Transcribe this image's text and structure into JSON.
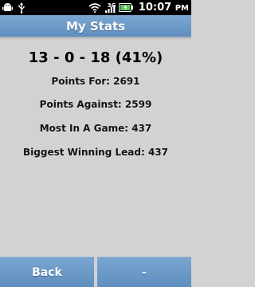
{
  "status_bar": {
    "time": "10:07",
    "ampm": "PM",
    "network_label": "3G",
    "icons": [
      "android-debug-icon",
      "usb-icon",
      "wifi-icon",
      "signal-icon",
      "battery-icon"
    ]
  },
  "header": {
    "title": "My Stats"
  },
  "stats": {
    "record": "13 - 0 - 18 (41%)",
    "points_for": "Points For: 2691",
    "points_against": "Points Against: 2599",
    "most_in_game": "Most In A Game: 437",
    "biggest_winning_lead": "Biggest Winning Lead: 437"
  },
  "buttons": {
    "back_label": "Back",
    "second_label": "-"
  },
  "colors": {
    "header_bg": "#6f9ac8",
    "button_bg": "#6d99c8",
    "body_bg": "#d2d2d2",
    "status_bar_bg": "#000000"
  }
}
